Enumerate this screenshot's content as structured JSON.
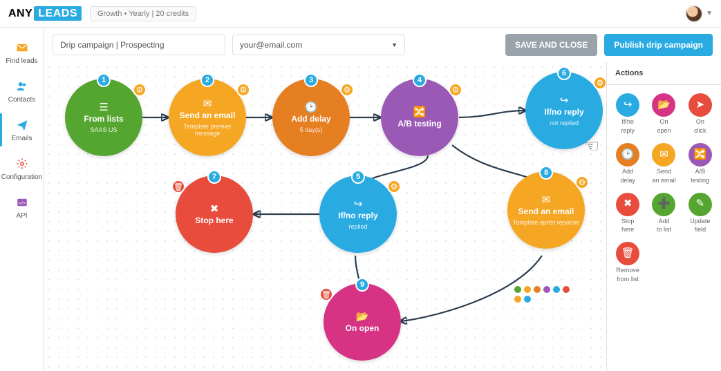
{
  "header": {
    "logo_a": "ANY",
    "logo_b": "LEADS",
    "plan": "Growth • Yearly | 20 credits"
  },
  "sidebar": {
    "items": [
      {
        "label": "Find leads"
      },
      {
        "label": "Contacts"
      },
      {
        "label": "Emails"
      },
      {
        "label": "Configuration"
      },
      {
        "label": "API"
      }
    ]
  },
  "toolbar": {
    "name": "Drip campaign | Prospecting",
    "email": "your@email.com",
    "save_close": "SAVE AND CLOSE",
    "publish": "Publish drip campaign"
  },
  "nodes": {
    "n1": {
      "num": "1",
      "title": "From lists",
      "sub": "SAAS US"
    },
    "n2": {
      "num": "2",
      "title": "Send an email",
      "sub": "Template premier message"
    },
    "n3": {
      "num": "3",
      "title": "Add delay",
      "sub": "5 day(s)"
    },
    "n4": {
      "num": "4",
      "title": "A/B testing",
      "sub": ""
    },
    "n5": {
      "num": "5",
      "title": "If/no reply",
      "sub": "replied"
    },
    "n6": {
      "num": "6",
      "title": "If/no reply",
      "sub": "not replied"
    },
    "n7": {
      "num": "7",
      "title": "Stop here",
      "sub": ""
    },
    "n8": {
      "num": "8",
      "title": "Send an email",
      "sub": "Template après reponse"
    },
    "n9": {
      "num": "9",
      "title": "On open",
      "sub": ""
    }
  },
  "actions": {
    "heading": "Actions",
    "items": [
      {
        "label1": "If/no",
        "label2": "reply",
        "color": "#29abe2"
      },
      {
        "label1": "On",
        "label2": "open",
        "color": "#d63384"
      },
      {
        "label1": "On",
        "label2": "click",
        "color": "#e74c3c"
      },
      {
        "label1": "Add",
        "label2": "delay",
        "color": "#e67e22"
      },
      {
        "label1": "Send",
        "label2": "an email",
        "color": "#f5a623"
      },
      {
        "label1": "A/B",
        "label2": "testing",
        "color": "#9b59b6"
      },
      {
        "label1": "Stop",
        "label2": "here",
        "color": "#e74c3c"
      },
      {
        "label1": "Add",
        "label2": "to list",
        "color": "#55a630"
      },
      {
        "label1": "Update",
        "label2": "field",
        "color": "#55a630"
      },
      {
        "label1": "Remove",
        "label2": "from list",
        "color": "#e74c3c"
      }
    ]
  },
  "palette_colors": [
    "#55a630",
    "#f5a623",
    "#e67e22",
    "#9b59b6",
    "#29abe2",
    "#e74c3c",
    "#f5a623",
    "#29abe2"
  ]
}
